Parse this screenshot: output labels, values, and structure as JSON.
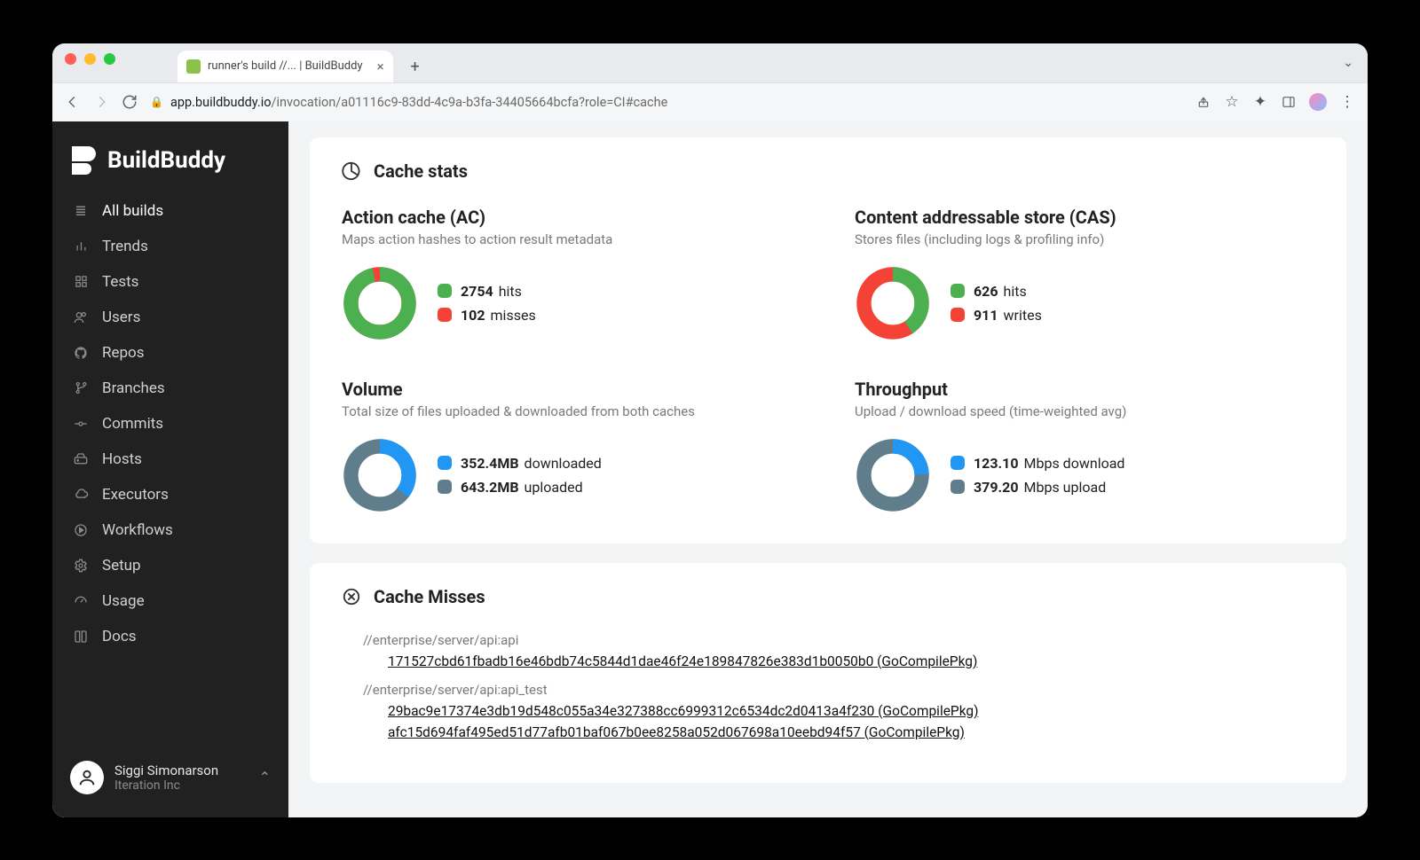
{
  "chrome": {
    "tab_title": "runner's build //... | BuildBuddy",
    "url_host": "app.buildbuddy.io",
    "url_path": "/invocation/a01116c9-83dd-4c9a-b3fa-34405664bcfa?role=CI#cache"
  },
  "sidebar": {
    "brand": "BuildBuddy",
    "items": [
      {
        "label": "All builds"
      },
      {
        "label": "Trends"
      },
      {
        "label": "Tests"
      },
      {
        "label": "Users"
      },
      {
        "label": "Repos"
      },
      {
        "label": "Branches"
      },
      {
        "label": "Commits"
      },
      {
        "label": "Hosts"
      },
      {
        "label": "Executors"
      },
      {
        "label": "Workflows"
      },
      {
        "label": "Setup"
      },
      {
        "label": "Usage"
      },
      {
        "label": "Docs"
      }
    ],
    "user": {
      "name": "Siggi Simonarson",
      "org": "Iteration Inc"
    }
  },
  "cache_stats": {
    "title": "Cache stats",
    "ac": {
      "title": "Action cache (AC)",
      "subtitle": "Maps action hashes to action result metadata",
      "hits": "2754",
      "hits_label": "hits",
      "misses": "102",
      "misses_label": "misses"
    },
    "cas": {
      "title": "Content addressable store (CAS)",
      "subtitle": "Stores files (including logs & profiling info)",
      "hits": "626",
      "hits_label": "hits",
      "writes": "911",
      "writes_label": "writes"
    },
    "volume": {
      "title": "Volume",
      "subtitle": "Total size of files uploaded & downloaded from both caches",
      "downloaded": "352.4MB",
      "downloaded_label": "downloaded",
      "uploaded": "643.2MB",
      "uploaded_label": "uploaded"
    },
    "throughput": {
      "title": "Throughput",
      "subtitle": "Upload / download speed (time-weighted avg)",
      "download": "123.10",
      "download_label": "Mbps download",
      "upload": "379.20",
      "upload_label": "Mbps upload"
    }
  },
  "cache_misses": {
    "title": "Cache Misses",
    "groups": [
      {
        "path": "//enterprise/server/api:api",
        "links": [
          "171527cbd61fbadb16e46bdb74c5844d1dae46f24e189847826e383d1b0050b0 (GoCompilePkg)"
        ]
      },
      {
        "path": "//enterprise/server/api:api_test",
        "links": [
          "29bac9e17374e3db19d548c055a34e327388cc6999312c6534dc2d0413a4f230 (GoCompilePkg)",
          "afc15d694faf495ed51d77afb01baf067b0ee8258a052d067698a10eebd94f57 (GoCompilePkg)"
        ]
      }
    ]
  },
  "chart_data": [
    {
      "type": "pie",
      "title": "Action cache (AC)",
      "series": [
        {
          "name": "hits",
          "values": [
            2754
          ]
        },
        {
          "name": "misses",
          "values": [
            102
          ]
        }
      ],
      "colors": [
        "#4caf50",
        "#f44336"
      ]
    },
    {
      "type": "pie",
      "title": "Content addressable store (CAS)",
      "series": [
        {
          "name": "hits",
          "values": [
            626
          ]
        },
        {
          "name": "writes",
          "values": [
            911
          ]
        }
      ],
      "colors": [
        "#4caf50",
        "#f44336"
      ]
    },
    {
      "type": "pie",
      "title": "Volume",
      "series": [
        {
          "name": "downloaded",
          "values": [
            352.4
          ]
        },
        {
          "name": "uploaded",
          "values": [
            643.2
          ]
        }
      ],
      "colors": [
        "#2196f3",
        "#607d8b"
      ],
      "unit": "MB"
    },
    {
      "type": "pie",
      "title": "Throughput",
      "series": [
        {
          "name": "download",
          "values": [
            123.1
          ]
        },
        {
          "name": "upload",
          "values": [
            379.2
          ]
        }
      ],
      "colors": [
        "#2196f3",
        "#607d8b"
      ],
      "unit": "Mbps"
    }
  ]
}
